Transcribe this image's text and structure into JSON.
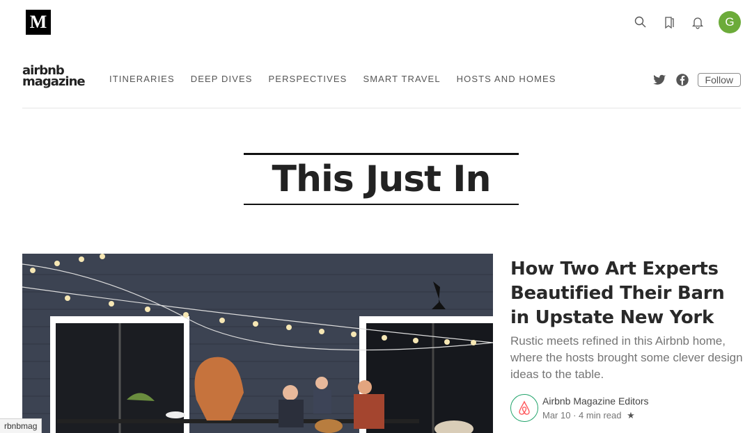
{
  "top": {
    "logo": "M",
    "avatar_letter": "G",
    "avatar_color": "#6cab3a"
  },
  "publication": {
    "logo_line1": "airbnb",
    "logo_line2": "magazine",
    "nav": [
      "ITINERARIES",
      "DEEP DIVES",
      "PERSPECTIVES",
      "SMART TRAVEL",
      "HOSTS AND HOMES"
    ],
    "follow_label": "Follow"
  },
  "section": {
    "title": "This Just In"
  },
  "story": {
    "title": "How Two Art Experts Beautified Their Barn in Upstate New York",
    "subtitle": "Rustic meets refined in this Airbnb home, where the hosts brought some clever design ideas to the table.",
    "author": "Airbnb Magazine Editors",
    "date": "Mar 10",
    "read_time": "4 min read",
    "star": "★"
  },
  "status_bar": "rbnbmag",
  "icons": [
    "search-icon",
    "bookmarks-icon",
    "bell-icon",
    "twitter-icon",
    "facebook-icon",
    "airbnb-logo-icon"
  ]
}
